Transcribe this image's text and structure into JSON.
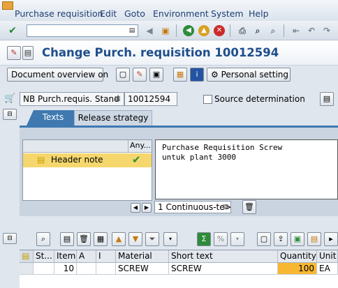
{
  "menu": {
    "items": [
      "Purchase requisition",
      "Edit",
      "Goto",
      "Environment",
      "System",
      "Help"
    ]
  },
  "toolbar": {
    "command_field_value": ""
  },
  "title": {
    "text": "Change Purch. requisition 10012594"
  },
  "app_toolbar": {
    "doc_overview_label": "Document overview on",
    "personal_setting_label": "Personal setting"
  },
  "header": {
    "doc_type": "NB Purch.requis. Stand",
    "doc_number": "10012594",
    "source_determination_label": "Source determination",
    "source_determination_checked": false
  },
  "tabs": {
    "texts": "Texts",
    "release_strategy": "Release strategy"
  },
  "texts": {
    "column_any": "Any...",
    "header_note_label": "Header note",
    "editor_lines": [
      "Purchase Requisition Screw",
      "untuk plant 3000"
    ],
    "format_select": "1 Continuous-te>"
  },
  "items_table": {
    "columns": [
      "St...",
      "Item",
      "A",
      "I",
      "Material",
      "Short text",
      "Quantity",
      "Unit"
    ],
    "rows": [
      {
        "status": "",
        "item": "10",
        "a": "",
        "i": "",
        "material": "SCREW",
        "short_text": "SCREW",
        "quantity": "100",
        "unit": "EA"
      }
    ]
  },
  "colors": {
    "title_blue": "#1f4e8c",
    "tab_active": "#3f79b0",
    "highlight_yellow": "#f5d76e",
    "quantity_orange": "#f7b733"
  }
}
